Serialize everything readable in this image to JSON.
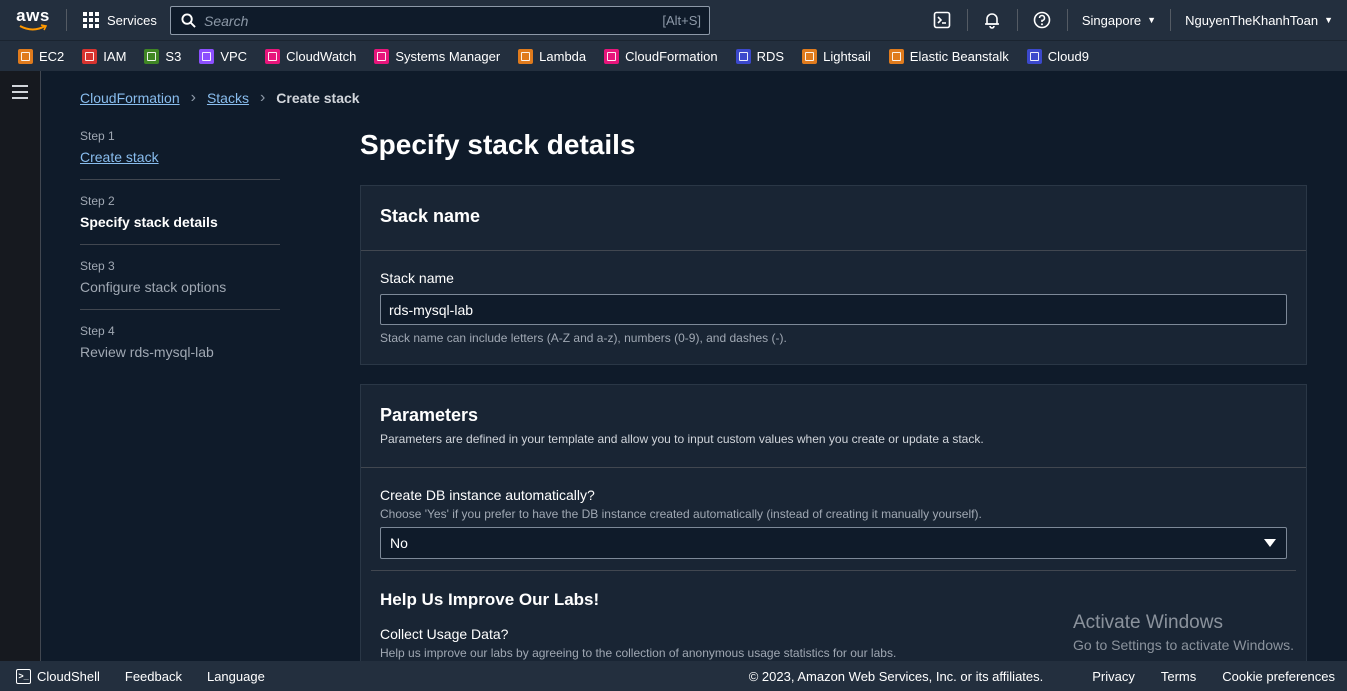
{
  "nav": {
    "logo_text": "aws",
    "services_label": "Services",
    "search_placeholder": "Search",
    "search_shortcut": "[Alt+S]",
    "region": "Singapore",
    "user": "NguyenTheKhanhToan"
  },
  "favorites": [
    {
      "label": "EC2",
      "color": "#e07b1d",
      "icon": "ec2-icon"
    },
    {
      "label": "IAM",
      "color": "#d6332f",
      "icon": "iam-icon"
    },
    {
      "label": "S3",
      "color": "#3f8624",
      "icon": "s3-icon"
    },
    {
      "label": "VPC",
      "color": "#8c4fff",
      "icon": "vpc-icon"
    },
    {
      "label": "CloudWatch",
      "color": "#e7157b",
      "icon": "cloudwatch-icon"
    },
    {
      "label": "Systems Manager",
      "color": "#e7157b",
      "icon": "systems-manager-icon"
    },
    {
      "label": "Lambda",
      "color": "#e07b1d",
      "icon": "lambda-icon"
    },
    {
      "label": "CloudFormation",
      "color": "#e7157b",
      "icon": "cloudformation-icon"
    },
    {
      "label": "RDS",
      "color": "#3b48cc",
      "icon": "rds-icon"
    },
    {
      "label": "Lightsail",
      "color": "#e07b1d",
      "icon": "lightsail-icon"
    },
    {
      "label": "Elastic Beanstalk",
      "color": "#e07b1d",
      "icon": "elastic-beanstalk-icon"
    },
    {
      "label": "Cloud9",
      "color": "#3b48cc",
      "icon": "cloud9-icon"
    }
  ],
  "breadcrumb": {
    "item1": "CloudFormation",
    "item2": "Stacks",
    "current": "Create stack"
  },
  "steps": [
    {
      "num": "Step 1",
      "title": "Create stack"
    },
    {
      "num": "Step 2",
      "title": "Specify stack details"
    },
    {
      "num": "Step 3",
      "title": "Configure stack options"
    },
    {
      "num": "Step 4",
      "title": "Review rds-mysql-lab"
    }
  ],
  "page_title": "Specify stack details",
  "stack_name": {
    "heading": "Stack name",
    "label": "Stack name",
    "value": "rds-mysql-lab",
    "hint": "Stack name can include letters (A-Z and a-z), numbers (0-9), and dashes (-)."
  },
  "parameters": {
    "heading": "Parameters",
    "description": "Parameters are defined in your template and allow you to input custom values when you create or update a stack.",
    "create_db_label": "Create DB instance automatically?",
    "create_db_desc": "Choose 'Yes' if you prefer to have the DB instance created automatically (instead of creating it manually yourself).",
    "create_db_value": "No",
    "improve_heading": "Help Us Improve Our Labs!",
    "usage_label": "Collect Usage Data?",
    "usage_desc": "Help us improve our labs by agreeing to the collection of anonymous usage statistics for our labs."
  },
  "watermark": {
    "line1": "Activate Windows",
    "line2": "Go to Settings to activate Windows."
  },
  "footer": {
    "cloudshell": "CloudShell",
    "feedback": "Feedback",
    "language": "Language",
    "copyright": "© 2023, Amazon Web Services, Inc. or its affiliates.",
    "privacy": "Privacy",
    "terms": "Terms",
    "cookies": "Cookie preferences"
  },
  "colors": {
    "nav_bg": "#232f3e",
    "page_bg": "#0f1b2a",
    "link": "#89bdee",
    "container_bg": "#192534"
  }
}
